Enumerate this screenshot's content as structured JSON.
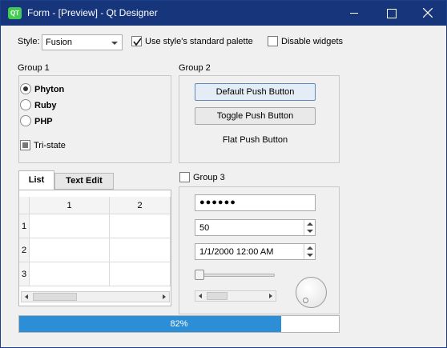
{
  "window": {
    "title": "Form - [Preview] - Qt Designer",
    "icon_text": "QT"
  },
  "toolbar": {
    "style_label": "Style:",
    "style_value": "Fusion",
    "use_palette_label": "Use style's standard palette",
    "use_palette_checked": true,
    "disable_widgets_label": "Disable widgets",
    "disable_widgets_checked": false
  },
  "group1": {
    "title": "Group 1",
    "radios": [
      {
        "label": "Phyton",
        "checked": true
      },
      {
        "label": "Ruby",
        "checked": false
      },
      {
        "label": "PHP",
        "checked": false
      }
    ],
    "tristate_label": "Tri-state"
  },
  "group2": {
    "title": "Group 2",
    "buttons": [
      "Default Push Button",
      "Toggle Push Button",
      "Flat Push Button"
    ]
  },
  "tabs": [
    "List",
    "Text Edit"
  ],
  "table": {
    "columns": [
      "1",
      "2"
    ],
    "rows": [
      "1",
      "2",
      "3"
    ]
  },
  "group3": {
    "title": "Group 3",
    "password": "●●●●●●",
    "spinbox_value": "50",
    "datetime_value": "1/1/2000 12:00 AM",
    "slider_value": 0,
    "dial_value": 0
  },
  "progress": {
    "value": 82,
    "label": "82%"
  },
  "colors": {
    "titlebar": "#17357a",
    "progress_fill": "#2d8ed8",
    "qt_green": "#41cd52"
  }
}
